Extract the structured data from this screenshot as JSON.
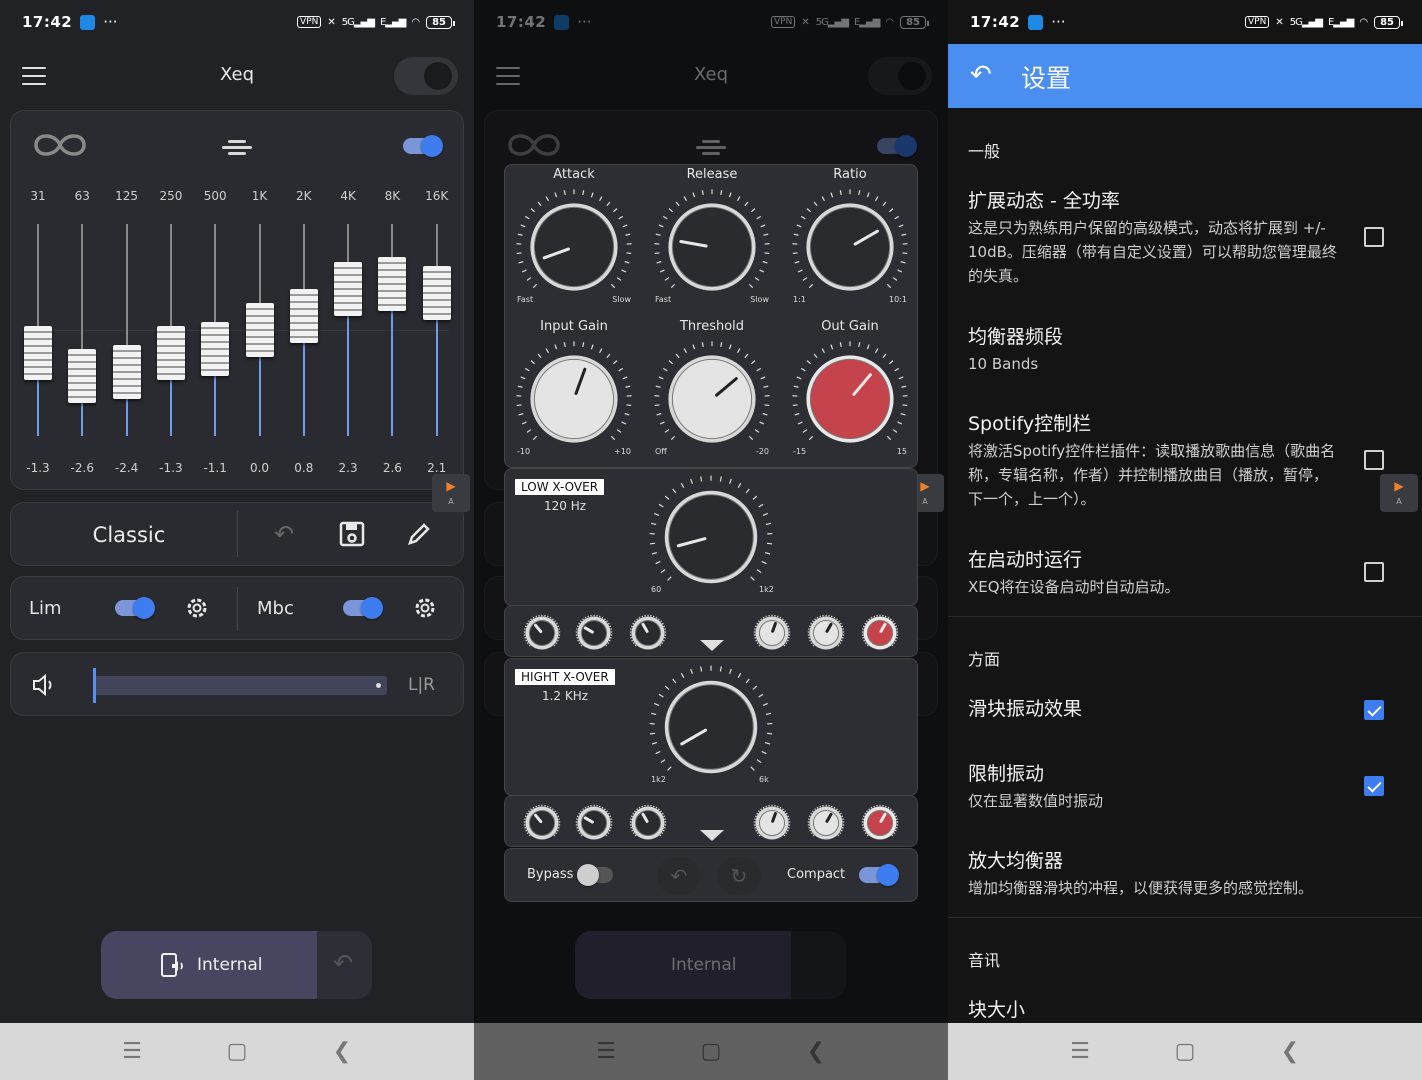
{
  "status": {
    "time": "17:42",
    "dots": "···",
    "vpn": "VPN",
    "net1": "5G",
    "net2": "E",
    "battery": "85"
  },
  "app": {
    "title": "Xeq"
  },
  "eq": {
    "frequencies": [
      "31",
      "63",
      "125",
      "250",
      "500",
      "1K",
      "2K",
      "4K",
      "8K",
      "16K"
    ],
    "gains_label": [
      "-1.3",
      "-2.6",
      "-2.4",
      "-1.3",
      "-1.1",
      "0.0",
      "0.8",
      "2.3",
      "2.6",
      "2.1"
    ],
    "gains": [
      -1.3,
      -2.6,
      -2.4,
      -1.3,
      -1.1,
      0.0,
      0.8,
      2.3,
      2.6,
      2.1
    ],
    "enabled": true
  },
  "preset": {
    "name": "Classic"
  },
  "toggles": {
    "lim_label": "Lim",
    "mbc_label": "Mbc",
    "lim_on": true,
    "mbc_on": true
  },
  "volume": {
    "lr_label": "L|R"
  },
  "source": {
    "label": "Internal"
  },
  "compressor": {
    "knobs": [
      {
        "label": "Attack",
        "min": "Fast",
        "max": "Slow",
        "angle": -110,
        "style": "dark"
      },
      {
        "label": "Release",
        "min": "Fast",
        "max": "Slow",
        "angle": -80,
        "style": "dark"
      },
      {
        "label": "Ratio",
        "min": "1:1",
        "max": "10:1",
        "angle": 60,
        "style": "dark"
      },
      {
        "label": "Input Gain",
        "min": "-10",
        "max": "+10",
        "angle": 20,
        "style": "light"
      },
      {
        "label": "Threshold",
        "min": "Off",
        "max": "-20",
        "angle": 50,
        "style": "light"
      },
      {
        "label": "Out Gain",
        "min": "-15",
        "max": "15",
        "angle": 40,
        "style": "red"
      }
    ],
    "low_xover": {
      "label": "LOW X-OVER",
      "value": "120 Hz",
      "min": "60",
      "max": "1k2",
      "angle": -105
    },
    "high_xover": {
      "label": "HIGHT X-OVER",
      "value": "1.2 KHz",
      "min": "1k2",
      "max": "6k",
      "angle": -120
    },
    "bypass_label": "Bypass",
    "bypass_on": false,
    "compact_label": "Compact",
    "compact_on": true
  },
  "settings": {
    "title": "设置",
    "sections": {
      "general": "一般",
      "aspect": "方面",
      "audio": "音讯"
    },
    "items": [
      {
        "title": "扩展动态 - 全功率",
        "desc": "这是只为熟练用户保留的高级模式，动态将扩展到 +/- 10dB。压缩器（带有自定义设置）可以帮助您管理最终的失真。",
        "checked": false
      },
      {
        "title": "均衡器频段",
        "desc": "10 Bands"
      },
      {
        "title": "Spotify控制栏",
        "desc": "将激活Spotify控件栏插件：读取播放歌曲信息（歌曲名称，专辑名称，作者）并控制播放曲目（播放，暂停，下一个，上一个）。",
        "checked": false
      },
      {
        "title": "在启动时运行",
        "desc": "XEQ将在设备启动时自动启动。",
        "checked": false
      },
      {
        "title": "滑块振动效果",
        "desc": "",
        "checked": true
      },
      {
        "title": "限制振动",
        "desc": "仅在显著数值时振动",
        "checked": true
      },
      {
        "title": "放大均衡器",
        "desc": "增加均衡器滑块的冲程，以便获得更多的感觉控制。"
      },
      {
        "title": "块大小",
        "desc": ""
      }
    ]
  },
  "colors": {
    "accent": "#3d7df0",
    "appbar": "#4a8ff0",
    "bg": "#212226"
  }
}
